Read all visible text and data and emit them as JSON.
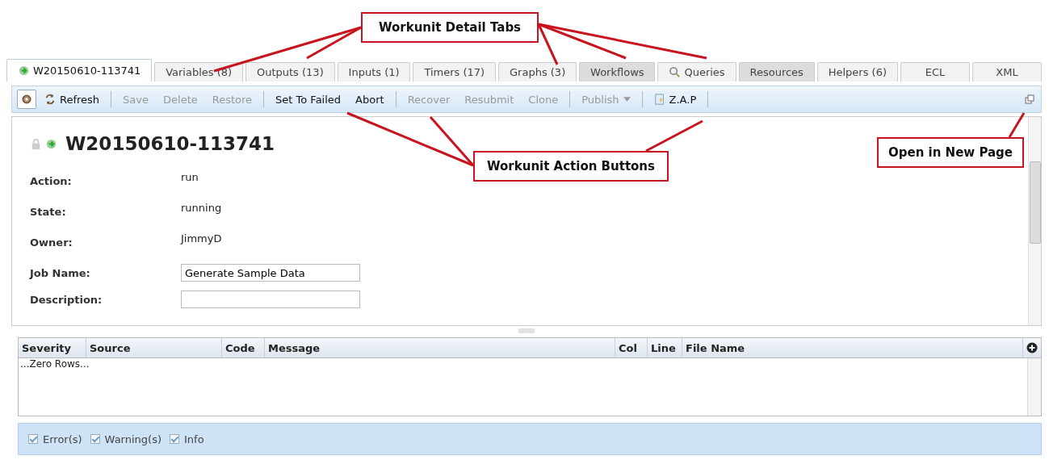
{
  "tabs": [
    {
      "label": "W20150610-113741",
      "selected": true,
      "shaded": false,
      "icon": true
    },
    {
      "label": "Variables (8)",
      "selected": false,
      "shaded": false
    },
    {
      "label": "Outputs (13)",
      "selected": false,
      "shaded": false
    },
    {
      "label": "Inputs (1)",
      "selected": false,
      "shaded": false
    },
    {
      "label": "Timers (17)",
      "selected": false,
      "shaded": false
    },
    {
      "label": "Graphs (3)",
      "selected": false,
      "shaded": false
    },
    {
      "label": "Workflows",
      "selected": false,
      "shaded": true
    },
    {
      "label": "Queries",
      "selected": false,
      "shaded": false,
      "search_icon": true
    },
    {
      "label": "Resources",
      "selected": false,
      "shaded": true
    },
    {
      "label": "Helpers (6)",
      "selected": false,
      "shaded": false
    },
    {
      "label": "ECL",
      "selected": false,
      "shaded": false
    },
    {
      "label": "XML",
      "selected": false,
      "shaded": false
    }
  ],
  "toolbar": [
    [
      {
        "label": "Refresh",
        "disabled": false,
        "kind": "refresh"
      }
    ],
    [
      {
        "label": "Save",
        "disabled": true,
        "kind": "plain"
      },
      {
        "label": "Delete",
        "disabled": true,
        "kind": "plain"
      },
      {
        "label": "Restore",
        "disabled": true,
        "kind": "plain"
      }
    ],
    [
      {
        "label": "Set To Failed",
        "disabled": false,
        "kind": "plain"
      },
      {
        "label": "Abort",
        "disabled": false,
        "kind": "plain"
      }
    ],
    [
      {
        "label": "Recover",
        "disabled": true,
        "kind": "plain"
      },
      {
        "label": "Resubmit",
        "disabled": true,
        "kind": "plain"
      },
      {
        "label": "Clone",
        "disabled": true,
        "kind": "plain"
      }
    ],
    [
      {
        "label": "Publish",
        "disabled": true,
        "kind": "dropdown"
      }
    ],
    [
      {
        "label": "Z.A.P",
        "disabled": false,
        "kind": "zap"
      }
    ]
  ],
  "detail": {
    "title": "W20150610-113741",
    "fields": [
      {
        "label": "Action:",
        "value": "run",
        "kind": "text"
      },
      {
        "label": "State:",
        "value": "running",
        "kind": "text"
      },
      {
        "label": "Owner:",
        "value": "JimmyD",
        "kind": "text"
      },
      {
        "label": "Job Name:",
        "value": "Generate Sample Data",
        "kind": "input"
      },
      {
        "label": "Description:",
        "kind": "input"
      }
    ]
  },
  "grid": {
    "columns": [
      "Severity",
      "Source",
      "Code",
      "Message",
      "Col",
      "Line",
      "File Name"
    ],
    "empty_message": "...Zero Rows..."
  },
  "filters": [
    {
      "label": "Error(s)",
      "checked": true
    },
    {
      "label": "Warning(s)",
      "checked": true
    },
    {
      "label": "Info",
      "checked": true
    }
  ],
  "annotations": [
    {
      "text": "Workunit Detail Tabs"
    },
    {
      "text": "Workunit Action Buttons"
    },
    {
      "text": "Open in New Page"
    }
  ]
}
